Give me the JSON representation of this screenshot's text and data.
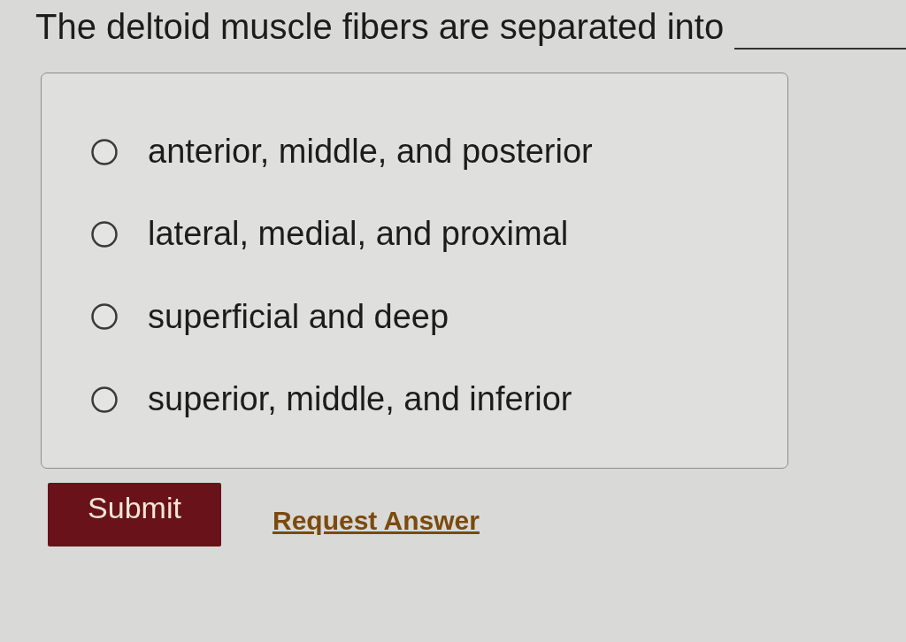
{
  "question": {
    "text": "The deltoid muscle fibers are separated into"
  },
  "options": [
    {
      "label": "anterior, middle, and posterior",
      "selected": false
    },
    {
      "label": "lateral, medial, and proximal",
      "selected": false
    },
    {
      "label": "superficial and deep",
      "selected": false
    },
    {
      "label": "superior, middle, and inferior",
      "selected": false
    }
  ],
  "submit_button": {
    "label": "Submit"
  },
  "request_answer_link": {
    "label": "Request Answer"
  }
}
